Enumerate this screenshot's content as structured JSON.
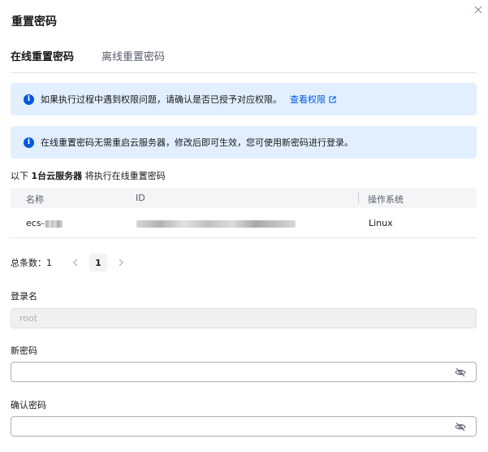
{
  "dialog": {
    "title": "重置密码"
  },
  "tabs": [
    {
      "label": "在线重置密码",
      "active": true
    },
    {
      "label": "离线重置密码",
      "active": false
    }
  ],
  "alerts": [
    {
      "text": "如果执行过程中遇到权限问题，请确认是否已授予对应权限。",
      "link": "查看权限"
    },
    {
      "text": "在线重置密码无需重启云服务器，修改后即可生效，您可使用新密码进行登录。"
    }
  ],
  "summary": {
    "prefix": "以下 ",
    "count_text": "1台云服务器",
    "suffix": " 将执行在线重置密码"
  },
  "table": {
    "columns": [
      "名称",
      "ID",
      "操作系统"
    ],
    "rows": [
      {
        "name": "ecs-",
        "id": "",
        "os": "Linux"
      }
    ]
  },
  "pagination": {
    "total_label": "总条数：",
    "total": "1",
    "current_page": "1"
  },
  "form": {
    "login_label": "登录名",
    "login_value": "root",
    "new_password_label": "新密码",
    "confirm_password_label": "确认密码"
  },
  "colors": {
    "accent": "#0058de",
    "alert_bg": "#e1efff"
  }
}
